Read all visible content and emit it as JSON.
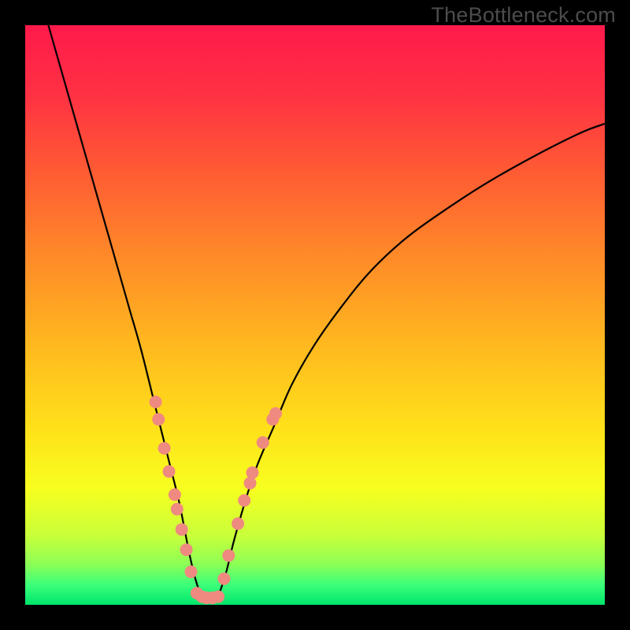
{
  "watermark": "TheBottleneck.com",
  "gradient": {
    "stops": [
      {
        "offset": 0.0,
        "color": "#ff1a4b"
      },
      {
        "offset": 0.12,
        "color": "#ff3143"
      },
      {
        "offset": 0.25,
        "color": "#ff5a34"
      },
      {
        "offset": 0.4,
        "color": "#ff8a28"
      },
      {
        "offset": 0.55,
        "color": "#ffb81f"
      },
      {
        "offset": 0.7,
        "color": "#ffe21a"
      },
      {
        "offset": 0.8,
        "color": "#f7ff1f"
      },
      {
        "offset": 0.88,
        "color": "#c9ff3a"
      },
      {
        "offset": 0.93,
        "color": "#8cff55"
      },
      {
        "offset": 0.965,
        "color": "#3dff7a"
      },
      {
        "offset": 1.0,
        "color": "#00e56b"
      }
    ]
  },
  "chart_data": {
    "type": "line",
    "title": "",
    "xlabel": "",
    "ylabel": "",
    "xlim": [
      0,
      100
    ],
    "ylim": [
      0,
      100
    ],
    "note": "Axes are unlabeled percentage-like, values eyeballed from pixel positions. Curve resembles a bottleneck V; y = 100 - f(x) roughly, with a sharp minimum near x≈30.",
    "series": [
      {
        "name": "curve",
        "x": [
          4,
          6,
          8,
          10,
          12,
          14,
          16,
          18,
          20,
          22,
          23.5,
          25,
          26.5,
          27.5,
          28.5,
          29.5,
          30.5,
          31.5,
          33,
          34.5,
          36,
          38,
          40,
          43,
          46,
          50,
          55,
          60,
          66,
          73,
          80,
          88,
          96,
          100
        ],
        "y": [
          100,
          93,
          86,
          79,
          72,
          65,
          58,
          51,
          44,
          36,
          30,
          24,
          18,
          13,
          8,
          4,
          1.3,
          1.0,
          1.2,
          5,
          11,
          18,
          24,
          31,
          38,
          45,
          52,
          58,
          63.5,
          68.5,
          73,
          77.5,
          81.5,
          83
        ]
      }
    ],
    "markers": {
      "name": "highlight-points",
      "color": "#ef8a80",
      "radius_px": 8,
      "points": [
        {
          "x": 22.5,
          "y": 35
        },
        {
          "x": 23.0,
          "y": 32
        },
        {
          "x": 24.0,
          "y": 27
        },
        {
          "x": 24.8,
          "y": 23
        },
        {
          "x": 25.8,
          "y": 19
        },
        {
          "x": 26.2,
          "y": 16.5
        },
        {
          "x": 27.0,
          "y": 13
        },
        {
          "x": 27.8,
          "y": 9.5
        },
        {
          "x": 28.6,
          "y": 5.7
        },
        {
          "x": 29.6,
          "y": 2.0
        },
        {
          "x": 30.5,
          "y": 1.4
        },
        {
          "x": 31.3,
          "y": 1.2
        },
        {
          "x": 32.3,
          "y": 1.2
        },
        {
          "x": 33.3,
          "y": 1.4
        },
        {
          "x": 34.3,
          "y": 4.5
        },
        {
          "x": 35.1,
          "y": 8.5
        },
        {
          "x": 36.7,
          "y": 14
        },
        {
          "x": 37.8,
          "y": 18
        },
        {
          "x": 38.8,
          "y": 21
        },
        {
          "x": 39.2,
          "y": 22.8
        },
        {
          "x": 41.0,
          "y": 28
        },
        {
          "x": 42.7,
          "y": 32
        },
        {
          "x": 43.2,
          "y": 33
        }
      ]
    }
  }
}
